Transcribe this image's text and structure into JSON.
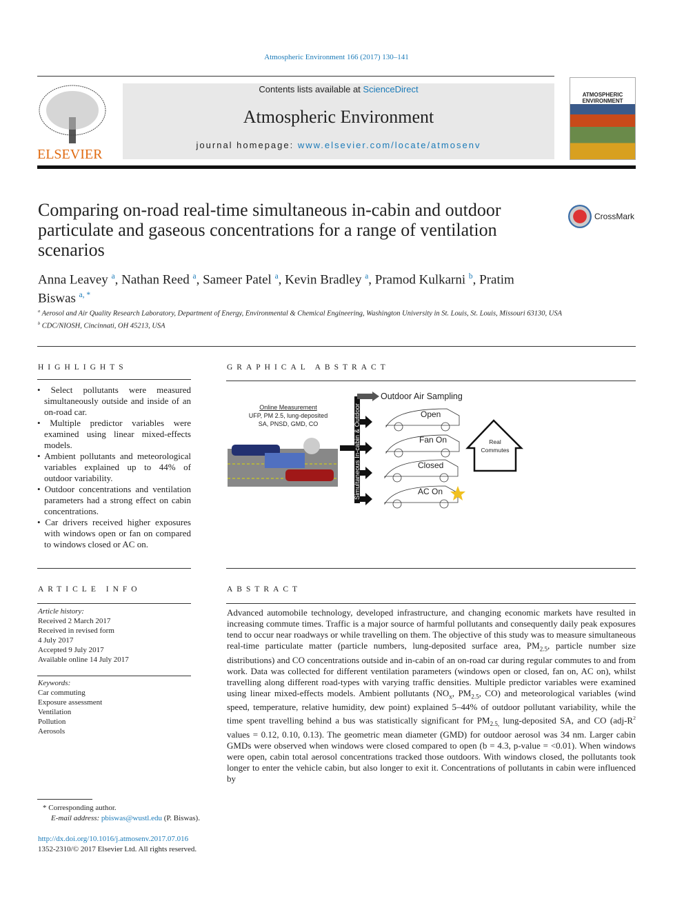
{
  "journal_ref": "Atmospheric Environment 166 (2017) 130–141",
  "banner": {
    "contents_prefix": "Contents lists available at ",
    "contents_link": "ScienceDirect",
    "journal_title": "Atmospheric Environment",
    "homepage_prefix": "journal homepage: ",
    "homepage_link": "www.elsevier.com/locate/atmosenv"
  },
  "publisher_logo": "ELSEVIER",
  "cover_text": "ATMOSPHERIC ENVIRONMENT",
  "crossmark": "CrossMark",
  "title": "Comparing on-road real-time simultaneous in-cabin and outdoor particulate and gaseous concentrations for a range of ventilation scenarios",
  "authors": [
    {
      "name": "Anna Leavey",
      "sup": "a"
    },
    {
      "name": "Nathan Reed",
      "sup": "a"
    },
    {
      "name": "Sameer Patel",
      "sup": "a"
    },
    {
      "name": "Kevin Bradley",
      "sup": "a"
    },
    {
      "name": "Pramod Kulkarni",
      "sup": "b"
    },
    {
      "name": "Pratim Biswas",
      "sup": "a, *"
    }
  ],
  "affiliations": [
    {
      "sup": "a",
      "text": "Aerosol and Air Quality Research Laboratory, Department of Energy, Environmental & Chemical Engineering, Washington University in St. Louis, St. Louis, Missouri 63130, USA"
    },
    {
      "sup": "b",
      "text": "CDC/NIOSH, Cincinnati, OH 45213, USA"
    }
  ],
  "highlights": {
    "heading": "HIGHLIGHTS",
    "items": [
      "Select pollutants were measured simultaneously outside and inside of an on-road car.",
      "Multiple predictor variables were examined using linear mixed-effects models.",
      "Ambient pollutants and meteorological variables explained up to 44% of outdoor variability.",
      "Outdoor concentrations and ventilation parameters had a strong effect on cabin concentrations.",
      "Car drivers received higher exposures with windows open or fan on compared to windows closed or AC on."
    ]
  },
  "graphical_abstract": {
    "heading": "GRAPHICAL ABSTRACT",
    "online_title": "Online Measurement",
    "online_lines": [
      "UFP, PM 2.5, lung-deposited",
      "SA, PNSD, GMD, CO"
    ],
    "vertical_label": "Simultaneous In-cabin & Outdoor",
    "outdoor": "Outdoor Air Sampling",
    "scenarios": [
      "Open",
      "Fan On",
      "Closed",
      "AC On"
    ],
    "house_lines": [
      "Real",
      "Commutes"
    ]
  },
  "article_info": {
    "heading": "ARTICLE INFO",
    "history_label": "Article history:",
    "history": [
      "Received 2 March 2017",
      "Received in revised form",
      "4 July 2017",
      "Accepted 9 July 2017",
      "Available online 14 July 2017"
    ],
    "keywords_label": "Keywords:",
    "keywords": [
      "Car commuting",
      "Exposure assessment",
      "Ventilation",
      "Pollution",
      "Aerosols"
    ]
  },
  "abstract": {
    "heading": "ABSTRACT",
    "segments": [
      {
        "t": "Advanced automobile technology, developed infrastructure, and changing economic markets have resulted in increasing commute times. Traffic is a major source of harmful pollutants and consequently daily peak exposures tend to occur near roadways or while travelling on them. The objective of this study was to measure simultaneous real-time particulate matter (particle numbers, lung-deposited surface area, PM"
      },
      {
        "sub": "2.5"
      },
      {
        "t": ", particle number size distributions) and CO concentrations outside and in-cabin of an on-road car during regular commutes to and from work. Data was collected for different ventilation parameters (windows open or closed, fan on, AC on), whilst travelling along different road-types with varying traffic densities. Multiple predictor variables were examined using linear mixed-effects models. Ambient pollutants (NO"
      },
      {
        "sub": "x"
      },
      {
        "t": ", PM"
      },
      {
        "sub": "2.5"
      },
      {
        "t": ", CO) and meteorological variables (wind speed, temperature, relative humidity, dew point) explained 5–44% of outdoor pollutant variability, while the time spent travelling behind a bus was statistically significant for PM"
      },
      {
        "sub": "2.5,"
      },
      {
        "t": " lung-deposited SA, and CO (adj-R"
      },
      {
        "sup": "2"
      },
      {
        "t": " values = 0.12, 0.10, 0.13). The geometric mean diameter (GMD) for outdoor aerosol was 34 nm. Larger cabin GMDs were observed when windows were closed compared to open (b = 4.3, p-value = <0.01). When windows were open, cabin total aerosol concentrations tracked those outdoors. With windows closed, the pollutants took longer to enter the vehicle cabin, but also longer to exit it. Concentrations of pollutants in cabin were influenced by"
      }
    ]
  },
  "footnote": {
    "star": "*",
    "corresponding": "Corresponding author.",
    "email_label": "E-mail address:",
    "email": "pbiswas@wustl.edu",
    "email_suffix": " (P. Biswas).",
    "doi": "http://dx.doi.org/10.1016/j.atmosenv.2017.07.016",
    "copyright": "1352-2310/© 2017 Elsevier Ltd. All rights reserved."
  }
}
